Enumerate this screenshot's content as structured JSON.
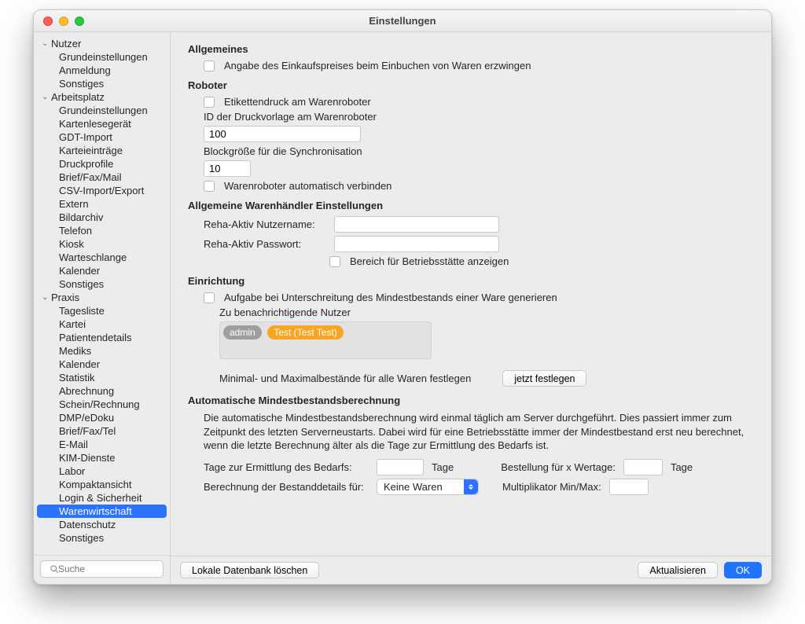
{
  "window_title": "Einstellungen",
  "sidebar": {
    "search_placeholder": "Suche",
    "groups": [
      {
        "label": "Nutzer",
        "items": [
          "Grundeinstellungen",
          "Anmeldung",
          "Sonstiges"
        ]
      },
      {
        "label": "Arbeitsplatz",
        "items": [
          "Grundeinstellungen",
          "Kartenlesegerät",
          "GDT-Import",
          "Karteieinträge",
          "Druckprofile",
          "Brief/Fax/Mail",
          "CSV-Import/Export",
          "Extern",
          "Bildarchiv",
          "Telefon",
          "Kiosk",
          "Warteschlange",
          "Kalender",
          "Sonstiges"
        ]
      },
      {
        "label": "Praxis",
        "items": [
          "Tagesliste",
          "Kartei",
          "Patientendetails",
          "Mediks",
          "Kalender",
          "Statistik",
          "Abrechnung",
          "Schein/Rechnung",
          "DMP/eDoku",
          "Brief/Fax/Tel",
          "E-Mail",
          "KIM-Dienste",
          "Labor",
          "Kompaktansicht",
          "Login & Sicherheit",
          "Warenwirtschaft",
          "Datenschutz",
          "Sonstiges"
        ]
      }
    ],
    "selected": "Warenwirtschaft"
  },
  "sections": {
    "allgemeines": {
      "title": "Allgemeines",
      "chk1": "Angabe des Einkaufspreises beim Einbuchen von Waren erzwingen"
    },
    "roboter": {
      "title": "Roboter",
      "chk1": "Etikettendruck am Warenroboter",
      "lbl_id": "ID der Druckvorlage am Warenroboter",
      "val_id": "100",
      "lbl_block": "Blockgröße für die Synchronisation",
      "val_block": "10",
      "chk2": "Warenroboter automatisch verbinden"
    },
    "haendler": {
      "title": "Allgemeine Warenhändler Einstellungen",
      "lbl_user": "Reha-Aktiv Nutzername:",
      "lbl_pass": "Reha-Aktiv Passwort:",
      "val_user": "",
      "val_pass": "",
      "chk1": "Bereich für Betriebsstätte anzeigen"
    },
    "einrichtung": {
      "title": "Einrichtung",
      "chk1": "Aufgabe bei Unterschreitung des Mindestbestands einer Ware generieren",
      "lbl_notify": "Zu benachrichtigende Nutzer",
      "tokens": [
        "admin",
        "Test (Test Test)"
      ],
      "lbl_minmax": "Minimal- und Maximalbestände für alle Waren festlegen",
      "btn_now": "jetzt festlegen"
    },
    "auto": {
      "title": "Automatische Mindestbestandsberechnung",
      "para": "Die automatische Mindestbestandsberechnung wird einmal täglich am Server durchgeführt. Dies passiert immer zum Zeitpunkt des letzten Serverneustarts. Dabei wird für eine Betriebsstätte immer der Mindestbestand erst neu berechnet, wenn die letzte Berechnung älter als die Tage zur Ermittlung des Bedarfs ist.",
      "lbl_days_demand": "Tage zur Ermittlung des Bedarfs:",
      "unit_days": "Tage",
      "lbl_order_days": "Bestellung für x Wertage:",
      "lbl_calc_for": "Berechnung der Bestanddetails für:",
      "sel_calc_for": "Keine Waren",
      "lbl_mult": "Multiplikator Min/Max:"
    }
  },
  "footer": {
    "delete_db": "Lokale Datenbank löschen",
    "refresh": "Aktualisieren",
    "ok": "OK"
  }
}
